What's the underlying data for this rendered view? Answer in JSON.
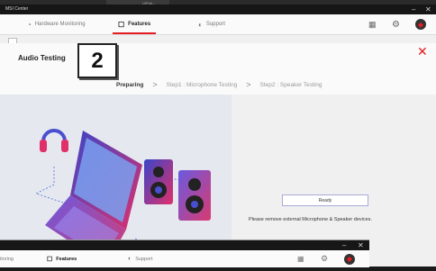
{
  "app": {
    "title": "MSI Center"
  },
  "background_window": {
    "top_tabs": [
      "",
      "LitPub..."
    ]
  },
  "nav": {
    "items": [
      {
        "label": "Hardware Monitoring",
        "icon": "gauge-icon"
      },
      {
        "label": "Features",
        "icon": "features-icon"
      },
      {
        "label": "Support",
        "icon": "support-icon"
      }
    ]
  },
  "dialog": {
    "title": "Audio Testing",
    "badge": "2",
    "steps": [
      {
        "label": "Preparing",
        "active": true
      },
      {
        "label": "Step1 : Microphone Testing",
        "active": false
      },
      {
        "label": "Step2 : Speaker Testing",
        "active": false
      }
    ],
    "step_separator": ">",
    "message": "Please remove external Microphone & Speaker devices.",
    "ready_label": "Ready"
  },
  "bottom_window": {
    "items": [
      {
        "label": "itoring"
      },
      {
        "label": "Features"
      },
      {
        "label": "Support"
      }
    ]
  },
  "colors": {
    "accent": "#e51c23",
    "titlebar": "#161616"
  }
}
